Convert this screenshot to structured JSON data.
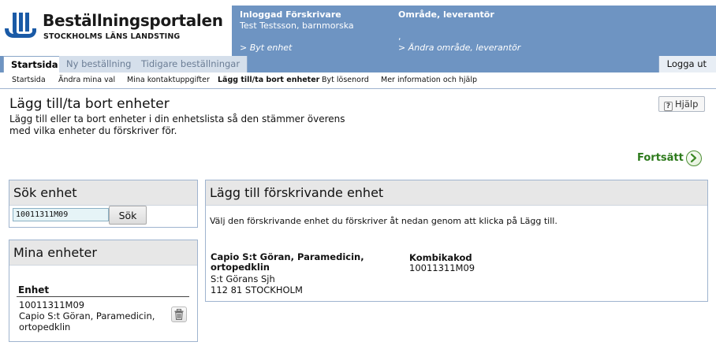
{
  "brand": {
    "title": "Beställningsportalen",
    "subtitle": "STOCKHOLMS LÄNS LANDSTING",
    "color": "#1a5aa6"
  },
  "user_info": {
    "title": "Inloggad Förskrivare",
    "name": "Test Testsson, barnmorska",
    "change_link": "> Byt enhet"
  },
  "area_info": {
    "title": "Område, leverantör",
    "value": ",",
    "change_link": "> Ändra område, leverantör"
  },
  "tabs": [
    {
      "label": "Startsida",
      "active": true
    },
    {
      "label": "Ny beställning",
      "active": false
    },
    {
      "label": "Tidigare beställningar",
      "active": false
    }
  ],
  "logout_label": "Logga ut",
  "subnav": [
    {
      "label": "Startsida"
    },
    {
      "label": "Ändra mina val"
    },
    {
      "label": "Mina kontaktuppgifter"
    },
    {
      "label": "Lägg till/ta bort enheter",
      "current": true
    },
    {
      "label": "Byt lösenord"
    },
    {
      "label": "Mer information och hjälp"
    }
  ],
  "page": {
    "title": "Lägg till/ta bort enheter",
    "description": "Lägg till eller ta bort enheter i din enhetslista så den stämmer överens med vilka enheter du förskriver för.",
    "help_label": "Hjälp",
    "continue_label": "Fortsätt"
  },
  "search_panel": {
    "title": "Sök enhet",
    "input_value": "10011311M09",
    "button_label": "Sök"
  },
  "my_units_panel": {
    "title": "Mina enheter",
    "column_header": "Enhet",
    "units": [
      {
        "code": "10011311M09",
        "name_line1": "Capio S:t Göran, Paramedicin,",
        "name_line2": "ortopedklin"
      }
    ]
  },
  "add_panel": {
    "title": "Lägg till förskrivande enhet",
    "intro": "Välj den förskrivande enhet du förskriver åt nedan genom att klicka på Lägg till.",
    "result": {
      "name_line1": "Capio S:t Göran, Paramedicin,",
      "name_line2": "ortopedklin",
      "address_line1": "S:t Görans Sjh",
      "address_line2": "112 81 STOCKHOLM",
      "code_label": "Kombikakod",
      "code_value": "10011311M09"
    }
  },
  "colors": {
    "header_blue": "#6e94c2",
    "continue_green": "#2d7a1c",
    "panel_border": "#9fb4cf"
  }
}
